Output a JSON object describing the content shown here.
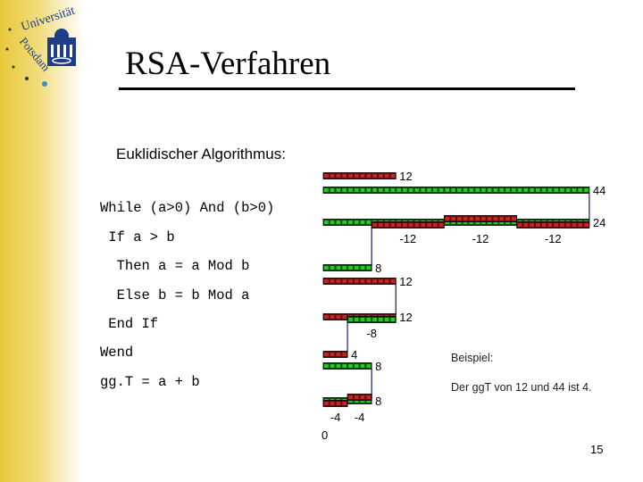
{
  "logo": {
    "text_top": "Universität",
    "text_side": "Potsdam",
    "colors": {
      "building": "#1f3c88",
      "dot": "#3a8fc8"
    }
  },
  "slide": {
    "title": "RSA-Verfahren",
    "subtitle": "Euklidischer Algorithmus:",
    "code_lines": [
      "While (a>0) And (b>0)",
      " If a > b",
      "  Then a = a Mod b",
      "  Else b = b Mod a",
      " End If",
      "Wend",
      "gg.T = a + b"
    ],
    "example_label": "Beispiel:",
    "example_text": "Der ggT von 12 und 44 ist 4.",
    "page_number": "15"
  },
  "diagram": {
    "colors": {
      "a": "#cc2222",
      "b": "#22cc22"
    },
    "rows": [
      {
        "bars": [
          {
            "color": "a",
            "start": 0,
            "length": 12
          }
        ],
        "label": "12"
      },
      {
        "bars": [
          {
            "color": "b",
            "start": 0,
            "length": 44
          }
        ],
        "label": "44"
      },
      {
        "bars": [
          {
            "color": "b",
            "start": 0,
            "length": 44
          },
          {
            "color": "a",
            "start": 8,
            "length": 12,
            "shift": "down"
          },
          {
            "color": "a",
            "start": 20,
            "length": 12,
            "shift": "up"
          },
          {
            "color": "a",
            "start": 32,
            "length": 12,
            "shift": "down"
          }
        ],
        "label": "24",
        "sub_labels": [
          {
            "at": 14,
            "text": "-12"
          },
          {
            "at": 26,
            "text": "-12"
          },
          {
            "at": 38,
            "text": "-12"
          }
        ]
      },
      {
        "bars": [
          {
            "color": "b",
            "start": 0,
            "length": 8
          }
        ],
        "label": "8"
      },
      {
        "bars": [
          {
            "color": "a",
            "start": 0,
            "length": 12
          }
        ],
        "label": "12"
      },
      {
        "bars": [
          {
            "color": "a",
            "start": 0,
            "length": 12
          },
          {
            "color": "b",
            "start": 4,
            "length": 8,
            "shift": "down"
          }
        ],
        "label": "12",
        "sub_labels": [
          {
            "at": 8,
            "text": "-8"
          }
        ]
      },
      {
        "bars": [
          {
            "color": "a",
            "start": 0,
            "length": 4
          }
        ],
        "label": "4"
      },
      {
        "bars": [
          {
            "color": "b",
            "start": 0,
            "length": 8
          }
        ],
        "label": "8"
      },
      {
        "bars": [
          {
            "color": "b",
            "start": 0,
            "length": 8
          },
          {
            "color": "a",
            "start": 0,
            "length": 4,
            "shift": "down"
          },
          {
            "color": "a",
            "start": 4,
            "length": 4,
            "shift": "up"
          }
        ],
        "label": "8",
        "sub_labels": [
          {
            "at": 2,
            "text": "-4"
          },
          {
            "at": 6,
            "text": "-4"
          }
        ]
      }
    ],
    "connectors": [
      {
        "at": 44,
        "from_row": 1,
        "to_row": 2
      },
      {
        "at": 8,
        "from_row": 2,
        "to_row": 3
      },
      {
        "at": 12,
        "from_row": 4,
        "to_row": 5
      },
      {
        "at": 4,
        "from_row": 5,
        "to_row": 6
      },
      {
        "at": 8,
        "from_row": 7,
        "to_row": 8
      }
    ],
    "zero_label": "0"
  }
}
